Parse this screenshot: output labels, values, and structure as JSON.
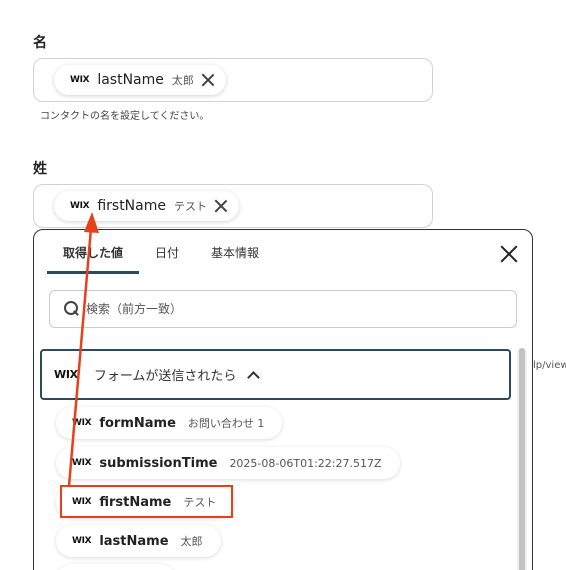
{
  "last_name_field": {
    "label": "名",
    "chip_source": "WIX",
    "chip_name": "lastName",
    "chip_value": "太郎",
    "hint": "コンタクトの名を設定してください。"
  },
  "first_name_field": {
    "label": "姓",
    "chip_source": "WIX",
    "chip_name": "firstName",
    "chip_value": "テスト"
  },
  "panel": {
    "tabs": [
      {
        "label": "取得した値"
      },
      {
        "label": "日付"
      },
      {
        "label": "基本情報"
      }
    ],
    "search_placeholder": "検索（前方一致）",
    "group": {
      "source": "WIX",
      "title": "フォームが送信されたら"
    },
    "items": [
      {
        "source": "WIX",
        "name": "formName",
        "value": "お問い合わせ 1"
      },
      {
        "source": "WIX",
        "name": "submissionTime",
        "value": "2025-08-06T01:22:27.517Z"
      },
      {
        "source": "WIX",
        "name": "firstName",
        "value": "テスト"
      },
      {
        "source": "WIX",
        "name": "lastName",
        "value": "太郎"
      }
    ]
  },
  "side_text": "lp/view",
  "annotation_color": "#e8401c",
  "accent_color": "#2c4a5c"
}
